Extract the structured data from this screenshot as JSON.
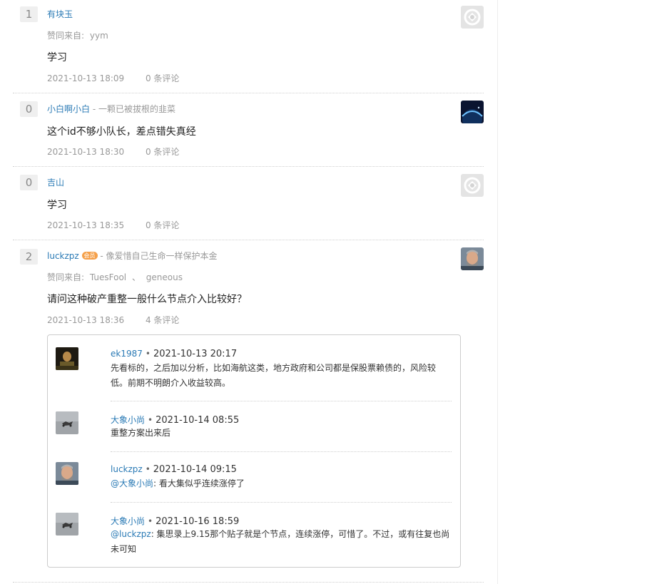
{
  "answers": [
    {
      "votes": "1",
      "author": "有块玉",
      "signature": "",
      "likes_label": "赞同来自:",
      "likers": [
        "yym"
      ],
      "content": "学习",
      "time": "2021-10-13 18:09",
      "comments": "0 条评论"
    },
    {
      "votes": "0",
      "author": "小白啊小白",
      "signature_sep": "-",
      "signature": "一颗已被拔根的韭菜",
      "content": "这个id不够小队长，差点错失真经",
      "time": "2021-10-13 18:30",
      "comments": "0 条评论"
    },
    {
      "votes": "0",
      "author": "吉山",
      "content": "学习",
      "time": "2021-10-13 18:35",
      "comments": "0 条评论"
    },
    {
      "votes": "2",
      "author": "luckzpz",
      "badge": "会员",
      "signature_sep": "-",
      "signature": "像爱惜自己生命一样保护本金",
      "likes_label": "赞同来自:",
      "likers": [
        "TuesFool",
        "geneous"
      ],
      "liker_sep": "、",
      "content": "请问这种破产重整一般什么节点介入比较好？",
      "time": "2021-10-13 18:36",
      "comments": "4 条评论"
    }
  ],
  "comment_thread": [
    {
      "author": "ek1987",
      "time": "2021-10-13 20:17",
      "body": "先看标的，之后加以分析，比如海航这类，地方政府和公司都是保股票赖债的，风险较低。前期不明朗介入收益较高。"
    },
    {
      "author": "大象小尚",
      "time": "2021-10-14 08:55",
      "body": "重整方案出来后"
    },
    {
      "author": "luckzpz",
      "time": "2021-10-14 09:15",
      "mention": "@大象小尚",
      "body": ": 看大集似乎连续涨停了"
    },
    {
      "author": "大象小尚",
      "time": "2021-10-16 18:59",
      "mention": "@luckzpz",
      "body": ": 集思录上9.15那个贴子就是个节点，连续涨停，可惜了。不过，或有往复也尚未可知"
    }
  ],
  "separator_dot": "•",
  "colors": {
    "link_blue": "#2a7ab5",
    "muted_gray": "#999999",
    "vote_bg": "#efefef",
    "badge_orange": "#f5a04a"
  }
}
